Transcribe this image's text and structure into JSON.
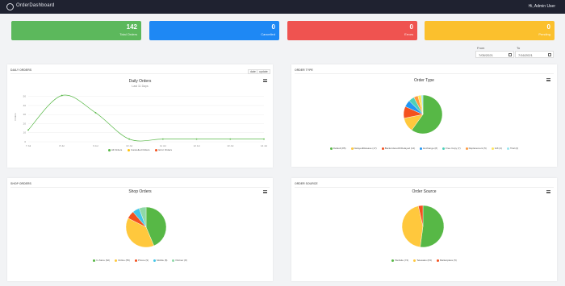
{
  "topbar": {
    "brand": "OrderDashboard",
    "user": "Hi, Admin User"
  },
  "stats": [
    {
      "value": "142",
      "label": "Total Orders",
      "color": "#5cb85c"
    },
    {
      "value": "0",
      "label": "Cancelled",
      "color": "#1e88f4"
    },
    {
      "value": "0",
      "label": "Errors",
      "color": "#ef5350"
    },
    {
      "value": "0",
      "label": "Pending",
      "color": "#fbc02d"
    }
  ],
  "dates": {
    "from_label": "From",
    "to_label": "To",
    "from_value": "7/05/2021",
    "to_value": "7/16/2021"
  },
  "daily": {
    "panel_title": "Daily Orders",
    "chart_title": "Daily Orders",
    "subtitle": "Last 11 Days",
    "btn_date": "date",
    "btn_update": "update",
    "menu": "chart-menu"
  },
  "order_type": {
    "panel_title": "Order Type",
    "chart_title": "Order Type"
  },
  "shop": {
    "panel_title": "Shop Orders",
    "chart_title": "Shop Orders"
  },
  "source": {
    "panel_title": "Order Source",
    "chart_title": "Order Source"
  },
  "chart_data": [
    {
      "type": "line",
      "title": "Daily Orders",
      "subtitle": "Last 11 Days",
      "ylabel": "Orders",
      "x": [
        "7 Jul",
        "8 Jul",
        "9 Jul",
        "10 Jul",
        "11 Jul",
        "12 Jul",
        "13 Jul",
        "14 Jul"
      ],
      "yticks": [
        "0",
        "10",
        "20",
        "30",
        "40",
        "50"
      ],
      "ylim": [
        0,
        55
      ],
      "series": [
        {
          "name": "All Orders",
          "color": "#57b846",
          "values": [
            13,
            51,
            32,
            3,
            3,
            3,
            3,
            3
          ]
        },
        {
          "name": "Cancelled Orders",
          "color": "#ffc107",
          "values": [
            0,
            0,
            0,
            0,
            0,
            0,
            0,
            0
          ]
        },
        {
          "name": "Error Orders",
          "color": "#f4511e",
          "values": [
            0,
            0,
            0,
            0,
            0,
            0,
            0,
            0
          ]
        }
      ],
      "legend_position": "bottom"
    },
    {
      "type": "pie",
      "title": "Order Type",
      "labels": [
        "Default",
        "DelayedRelease",
        "BackorderedOrDelayed",
        "Exchange",
        "Free Copy",
        "Replacement",
        "Gift",
        "Trial"
      ],
      "display_labels": [
        "Default (85)",
        "DelayedRelease (17)",
        "BackorderedOrDelayed (14)",
        "Exchange (8)",
        "Free Copy (7)",
        "Replacement (5)",
        "Gift (4)",
        "Trial (2)"
      ],
      "values": [
        85,
        17,
        14,
        8,
        7,
        5,
        4,
        2
      ],
      "colors": [
        "#57b846",
        "#ffc83d",
        "#f4511e",
        "#2196f3",
        "#4dd0b8",
        "#ff9a3d",
        "#ffe55c",
        "#9ae6ef"
      ],
      "legend_position": "bottom"
    },
    {
      "type": "pie",
      "title": "Shop Orders",
      "labels": [
        "In-Store",
        "Online",
        "Phone",
        "Mobile",
        "Partner"
      ],
      "display_labels": [
        "In-Store (62)",
        "Online (55)",
        "Phone (9)",
        "Mobile (8)",
        "Partner (8)"
      ],
      "values": [
        62,
        55,
        9,
        8,
        8
      ],
      "colors": [
        "#57b846",
        "#ffc83d",
        "#f4511e",
        "#43c6e8",
        "#8fd9a8"
      ],
      "legend_position": "bottom"
    },
    {
      "type": "pie",
      "title": "Order Source",
      "labels": [
        "Website",
        "Telesales",
        "Marketplace"
      ],
      "display_labels": [
        "Website (74)",
        "Telesales (63)",
        "Marketplace (5)"
      ],
      "values": [
        74,
        63,
        5
      ],
      "colors": [
        "#57b846",
        "#ffc83d",
        "#f4511e"
      ],
      "legend_position": "bottom"
    }
  ]
}
